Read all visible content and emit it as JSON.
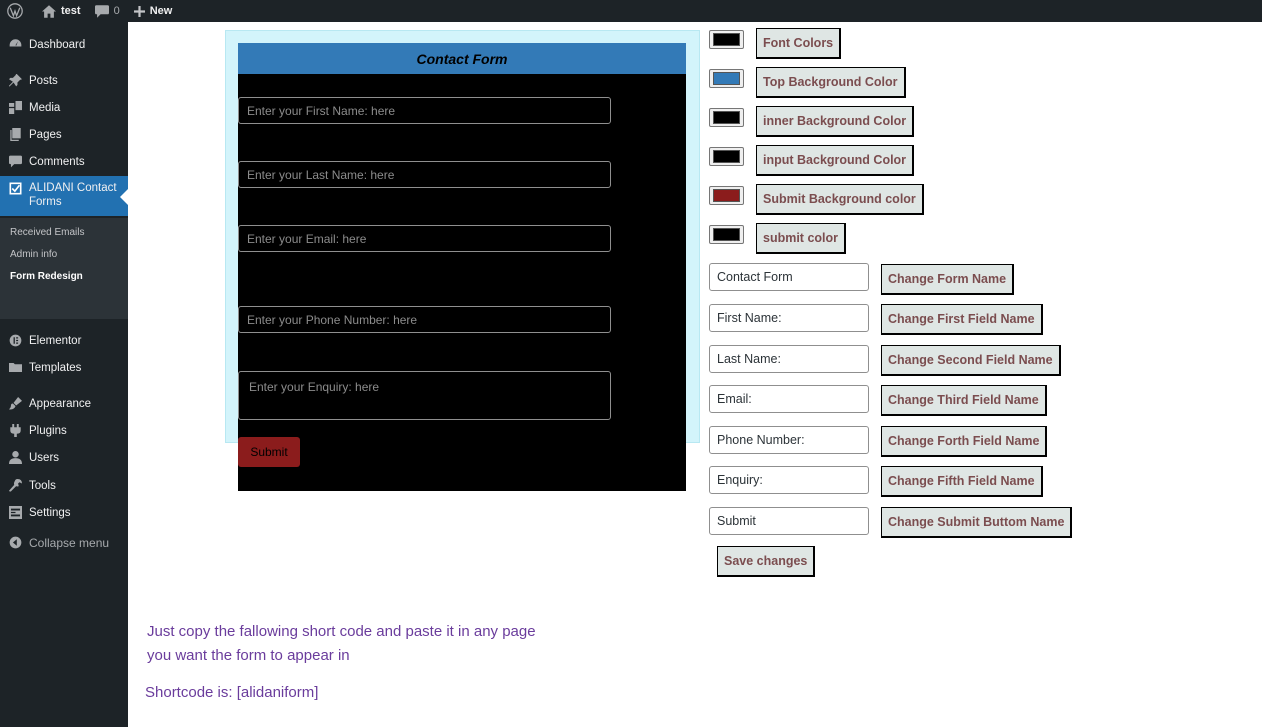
{
  "adminbar": {
    "site_name": "test",
    "comments_count": "0",
    "new_label": "New"
  },
  "sidebar": {
    "items": [
      {
        "label": "Dashboard",
        "icon": "dashboard-icon"
      },
      {
        "label": "Posts",
        "icon": "pin-icon"
      },
      {
        "label": "Media",
        "icon": "media-icon"
      },
      {
        "label": "Pages",
        "icon": "pages-icon"
      },
      {
        "label": "Comments",
        "icon": "comment-icon"
      },
      {
        "label": "ALIDANI Contact Forms",
        "icon": "form-icon"
      },
      {
        "label": "Elementor",
        "icon": "elementor-icon"
      },
      {
        "label": "Templates",
        "icon": "folder-icon"
      },
      {
        "label": "Appearance",
        "icon": "brush-icon"
      },
      {
        "label": "Plugins",
        "icon": "plugin-icon"
      },
      {
        "label": "Users",
        "icon": "user-icon"
      },
      {
        "label": "Tools",
        "icon": "wrench-icon"
      },
      {
        "label": "Settings",
        "icon": "settings-icon"
      }
    ],
    "submenu": [
      "Received Emails",
      "Admin info",
      "Form Redesign"
    ],
    "collapse_label": "Collapse menu"
  },
  "preview": {
    "title": "Contact Form",
    "first_placeholder": "Enter your First Name: here",
    "last_placeholder": "Enter your Last Name: here",
    "email_placeholder": "Enter your Email: here",
    "phone_placeholder": "Enter your Phone Number: here",
    "enquiry_placeholder": "Enter your Enquiry: here",
    "submit_label": "Submit"
  },
  "colors": {
    "font": "#000000",
    "top_background": "#337ab7",
    "inner_background": "#000000",
    "input_background": "#000000",
    "submit_background": "#8b1c1c",
    "submit": "#000000"
  },
  "color_buttons": {
    "font": "Font Colors",
    "top_background": "Top Background Color",
    "inner_background": "inner Background Color",
    "input_background": "input Background Color",
    "submit_background": "Submit Background color",
    "submit": "submit color"
  },
  "name_fields": {
    "form_name": {
      "value": "Contact Form",
      "button": "Change Form Name"
    },
    "first_field": {
      "value": "First Name:",
      "button": "Change First Field Name"
    },
    "second_field": {
      "value": "Last Name:",
      "button": "Change Second Field Name"
    },
    "third_field": {
      "value": "Email:",
      "button": "Change Third Field Name"
    },
    "fourth_field": {
      "value": "Phone Number:",
      "button": "Change Forth Field Name"
    },
    "fifth_field": {
      "value": "Enquiry:",
      "button": "Change Fifth Field Name"
    },
    "submit_field": {
      "value": "Submit",
      "button": "Change Submit Buttom Name"
    }
  },
  "save_label": "Save changes",
  "info": {
    "line1": "Just copy the fallowing short code and paste it in any page",
    "line2": "you want the form to appear in",
    "shortcode": "Shortcode is: [alidaniform]"
  }
}
